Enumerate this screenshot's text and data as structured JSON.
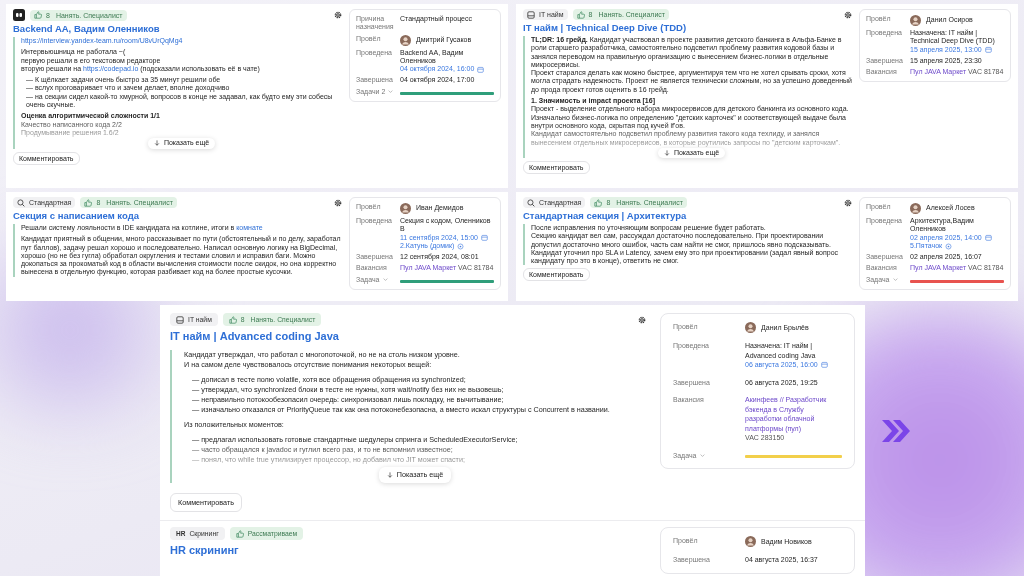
{
  "panels": [
    {
      "cards": [
        {
          "tags": [
            {
              "kind": "logo"
            }
          ],
          "verdict": {
            "score": "8",
            "label": "Нанять. Специалист"
          },
          "gear": true,
          "title": "Backend AA, Вадим Оленников",
          "body": [
            {
              "kind": "text",
              "lines": [
                {
                  "link": "https://interview.yandex-team.ru/room/U8vUrQqMg4"
                }
              ]
            },
            {
              "kind": "text",
              "lines": [
                "Интервьюшница не работала ~(",
                "первую решали в его текстовом редакторе",
                {
                  "before": "вторую решали на ",
                  "link": "https://codepad.io",
                  "after": " (подсказали использовать её в чате)"
                }
              ]
            },
            {
              "kind": "list",
              "lines": [
                "— К щёлкает задачи очень быстро за 35 минут решили обе",
                "— вслух проговаривает что и зачем делает, вполне доходчиво",
                "— на секции сидел какой-то хмурной, вопросов в конце не задавал, как будто ему эти собесы очень скучные."
              ]
            },
            {
              "kind": "text",
              "lines": [
                "**Оценка алгоритмической сложности 1/1**",
                "Качество написанного кода 2/2",
                "Продумывание решения 1.6/2"
              ]
            }
          ],
          "show_more": "Показать ещё",
          "comment": "Комментировать",
          "side": {
            "rows": [
              {
                "label": "Причина назначения",
                "kind": "text",
                "value": "Стандартный процесс"
              },
              {
                "label": "Провёл",
                "kind": "person",
                "value": "Дмитрий Гусаков"
              },
              {
                "label": "Проведена",
                "kind": "event",
                "value": "Backend AA, Вадим Оленников",
                "date": "04 октября 2024, 16:00"
              },
              {
                "label": "Завершена",
                "kind": "text",
                "value": "04 октября 2024, 17:00"
              }
            ],
            "task": {
              "label": "Задачи 2",
              "color": "#2f9e7a"
            }
          }
        }
      ]
    },
    {
      "cards": [
        {
          "tags": [
            {
              "kind": "standard",
              "label": "Стандартная"
            }
          ],
          "verdict": {
            "score": "8",
            "label": "Нанять. Специалист"
          },
          "gear": true,
          "title": "Секция с написанием кода",
          "body": [
            {
              "kind": "text",
              "lines": [
                {
                  "before": "Решали систему лояльности в IDE кандидата на котлине, итоги в ",
                  "link": "комнате"
                }
              ]
            },
            {
              "kind": "text",
              "lines": [
                "Кандидат приятный в общении, много рассказывает по пути (обстоятельный и по делу, заработал пут баллов), задачу решал хорошо и последовательно. Написал основную логику на BigDecimal, хорошо (но не без гугла) обработал округления и тестами словил и исправил баги. Можно докопаться за прокоматый код в области вычисления стоимости после скидок, но она корректно вынесена в отдельную функцию, которая разбивает код на более простые кусочки."
              ]
            }
          ],
          "side": {
            "rows": [
              {
                "label": "Провёл",
                "kind": "person",
                "value": "Иван Демидов"
              },
              {
                "label": "Проведена",
                "kind": "event",
                "value": "Секция с кодом, Оленников В",
                "date": "11 сентября 2024, 15:00",
                "room": "2.Катунь (домик)"
              },
              {
                "label": "Завершена",
                "kind": "text",
                "value": "12 сентября 2024, 08:01"
              },
              {
                "label": "Вакансия",
                "kind": "vacancy",
                "link": "Пул JAVA Маркет",
                "value": "VAC 81784"
              }
            ],
            "task": {
              "label": "Задача",
              "color": "#2f9e7a"
            }
          }
        }
      ]
    },
    {
      "cards": [
        {
          "tags": [
            {
              "kind": "it",
              "label": "IT найм"
            }
          ],
          "verdict": {
            "score": "8",
            "label": "Нанять. Специалист"
          },
          "gear": true,
          "title": "IT найм | Technical Deep Dive (TDD)",
          "body": [
            {
              "kind": "text",
              "lines": [
                "**TL;DR: 16 грейд.** Кандидат участвовал в проекте развития детского банкинга в Альфа-Банке в роли старшего разработчика, самостоятельно подсветил проблему развития кодовой базы и занялся переводом на правильную организацию с вынесением бизнес-логики в отдельные микросервисы.",
                "Проект старался делать как можно быстрее, аргументируя тем что не хотел срывать сроки, хотя могла страдать надежность. Проект не является технически сложным, но за успешно доведенный до прода проект готов оценить в 16 грейд."
              ]
            },
            {
              "kind": "text",
              "lines": [
                "**1. Значимость и impact проекта [16]**",
                "Проект - выделение отдельного набора микросервисов для детского банкинга из основного кода.",
                "Изначально бизнес-логика по определению \"детских карточек\" и соответствующей выдаче была внутри основного кода, скрытая под кучей if'ов.",
                "Кандидат самостоятельно подсветил проблему развития такого кода техлиду, и занялся вынесением отдельных микросервисов, в которые роутились запросы по \"детским карточкам\"."
              ]
            }
          ],
          "show_more": "Показать ещё",
          "comment": "Комментировать",
          "side": {
            "rows": [
              {
                "label": "Провёл",
                "kind": "person",
                "value": "Данил Осиров"
              },
              {
                "label": "Проведена",
                "kind": "event",
                "value": "Назначена: IT найм | Technical Deep Dive (TDD)",
                "date": "15 апреля 2025, 13:00"
              },
              {
                "label": "Завершена",
                "kind": "text",
                "value": "15 апреля 2025, 23:30"
              },
              {
                "label": "Вакансия",
                "kind": "vacancy",
                "link": "Пул JAVA Маркет",
                "value": "VAC 81784"
              }
            ]
          }
        }
      ]
    },
    {
      "cards": [
        {
          "tags": [
            {
              "kind": "standard",
              "label": "Стандартная"
            }
          ],
          "verdict": {
            "score": "8",
            "label": "Нанять. Специалист"
          },
          "gear": true,
          "title": "Стандартная секция | Архитектура",
          "body": [
            {
              "kind": "text",
              "lines": [
                "После исправления по уточняющим вопросам решение будет работать.",
                "Секцию кандидат вел сам, рассуждал достаточно последовательно. При проектировании допустил достаточно много ошибок, часть сам найти не смог, пришлось явно подсказывать. Кандидат уточнил про SLA и Latency, зачем ему это при проектировании (задал явный вопрос кандидату про это в конце), ответить не смог."
              ]
            }
          ],
          "comment": "Комментировать",
          "side": {
            "rows": [
              {
                "label": "Провёл",
                "kind": "person",
                "value": "Алексей Лосев"
              },
              {
                "label": "Проведена",
                "kind": "event",
                "value": "Архитектура,Вадим Оленников",
                "date": "02 апреля 2025, 14:00",
                "room": "5.Пятачок"
              },
              {
                "label": "Завершена",
                "kind": "text",
                "value": "02 апреля 2025, 16:07"
              },
              {
                "label": "Вакансия",
                "kind": "vacancy",
                "link": "Пул JAVA Маркет",
                "value": "VAC 81784"
              }
            ],
            "task": {
              "label": "Задача",
              "color": "#e8534f"
            }
          }
        }
      ]
    },
    {
      "cards": [
        {
          "tags": [
            {
              "kind": "it",
              "label": "IT найм"
            }
          ],
          "verdict": {
            "score": "8",
            "label": "Нанять. Специалист"
          },
          "gear": true,
          "title": "IT найм | Advanced coding Java",
          "body": [
            {
              "kind": "text",
              "lines": [
                "Кандидат утверждал, что работал с многопоточкой, но не на столь низком уровне.",
                "И на самом деле чувствовалось отсутствие понимания некоторых вещей:"
              ]
            },
            {
              "kind": "list",
              "lines": [
                "— дописал в тесте полю volatile, хотя все обращения обращения из synchronized;",
                "— утверждал, что synchronized блоки в тесте не нужны, хотя wait/notify без них не вызовешь;",
                "— неправильно потокообезопасил очередь: синхронизовал лишь покладку, не вычитывание;",
                "— изначально отказался от PriorityQueue так как она потоконебезопасна, а вместо искал структуры с Concurrent в названии."
              ]
            },
            {
              "kind": "text",
              "lines": [
                "Из положительных моментов:"
              ]
            },
            {
              "kind": "list",
              "lines": [
                "— предлагал использовать готовые стандартные шедулеры спринга и ScheduledExecutorService;",
                "— часто обращался к javadoc и гуглил всего раз, и то не вспомнил известное;",
                "— понял, что while true утилизирует процессор, но добавил что JIT может спасти;"
              ]
            }
          ],
          "show_more": "Показать ещё",
          "comment": "Комментировать",
          "side": {
            "rows": [
              {
                "label": "Провёл",
                "kind": "person",
                "value": "Данил Брылёв"
              },
              {
                "label": "Проведена",
                "kind": "event",
                "value": "Назначена: IT найм | Advanced coding Java",
                "date": "06 августа 2025, 16:00"
              },
              {
                "label": "Завершена",
                "kind": "text",
                "value": "06 августа 2025, 19:25"
              },
              {
                "label": "Вакансия",
                "kind": "vacancy",
                "link": "Акинфеев // Разработчик бэкенда в Службу разработки облачной платформы (пул)",
                "value": "VAC 283150"
              }
            ],
            "task": {
              "label": "Задача",
              "color": "#f2cf4a"
            }
          }
        },
        {
          "tags": [
            {
              "kind": "hr",
              "glyph": "HR",
              "label": "Скрининг"
            }
          ],
          "verdict": {
            "label": "Рассматриваем"
          },
          "title": "HR скрининг",
          "side": {
            "rows": [
              {
                "label": "Провёл",
                "kind": "person",
                "value": "Вадим Новиков"
              },
              {
                "label": "Завершена",
                "kind": "text",
                "value": "04 августа 2025, 16:37"
              }
            ]
          }
        }
      ]
    }
  ]
}
